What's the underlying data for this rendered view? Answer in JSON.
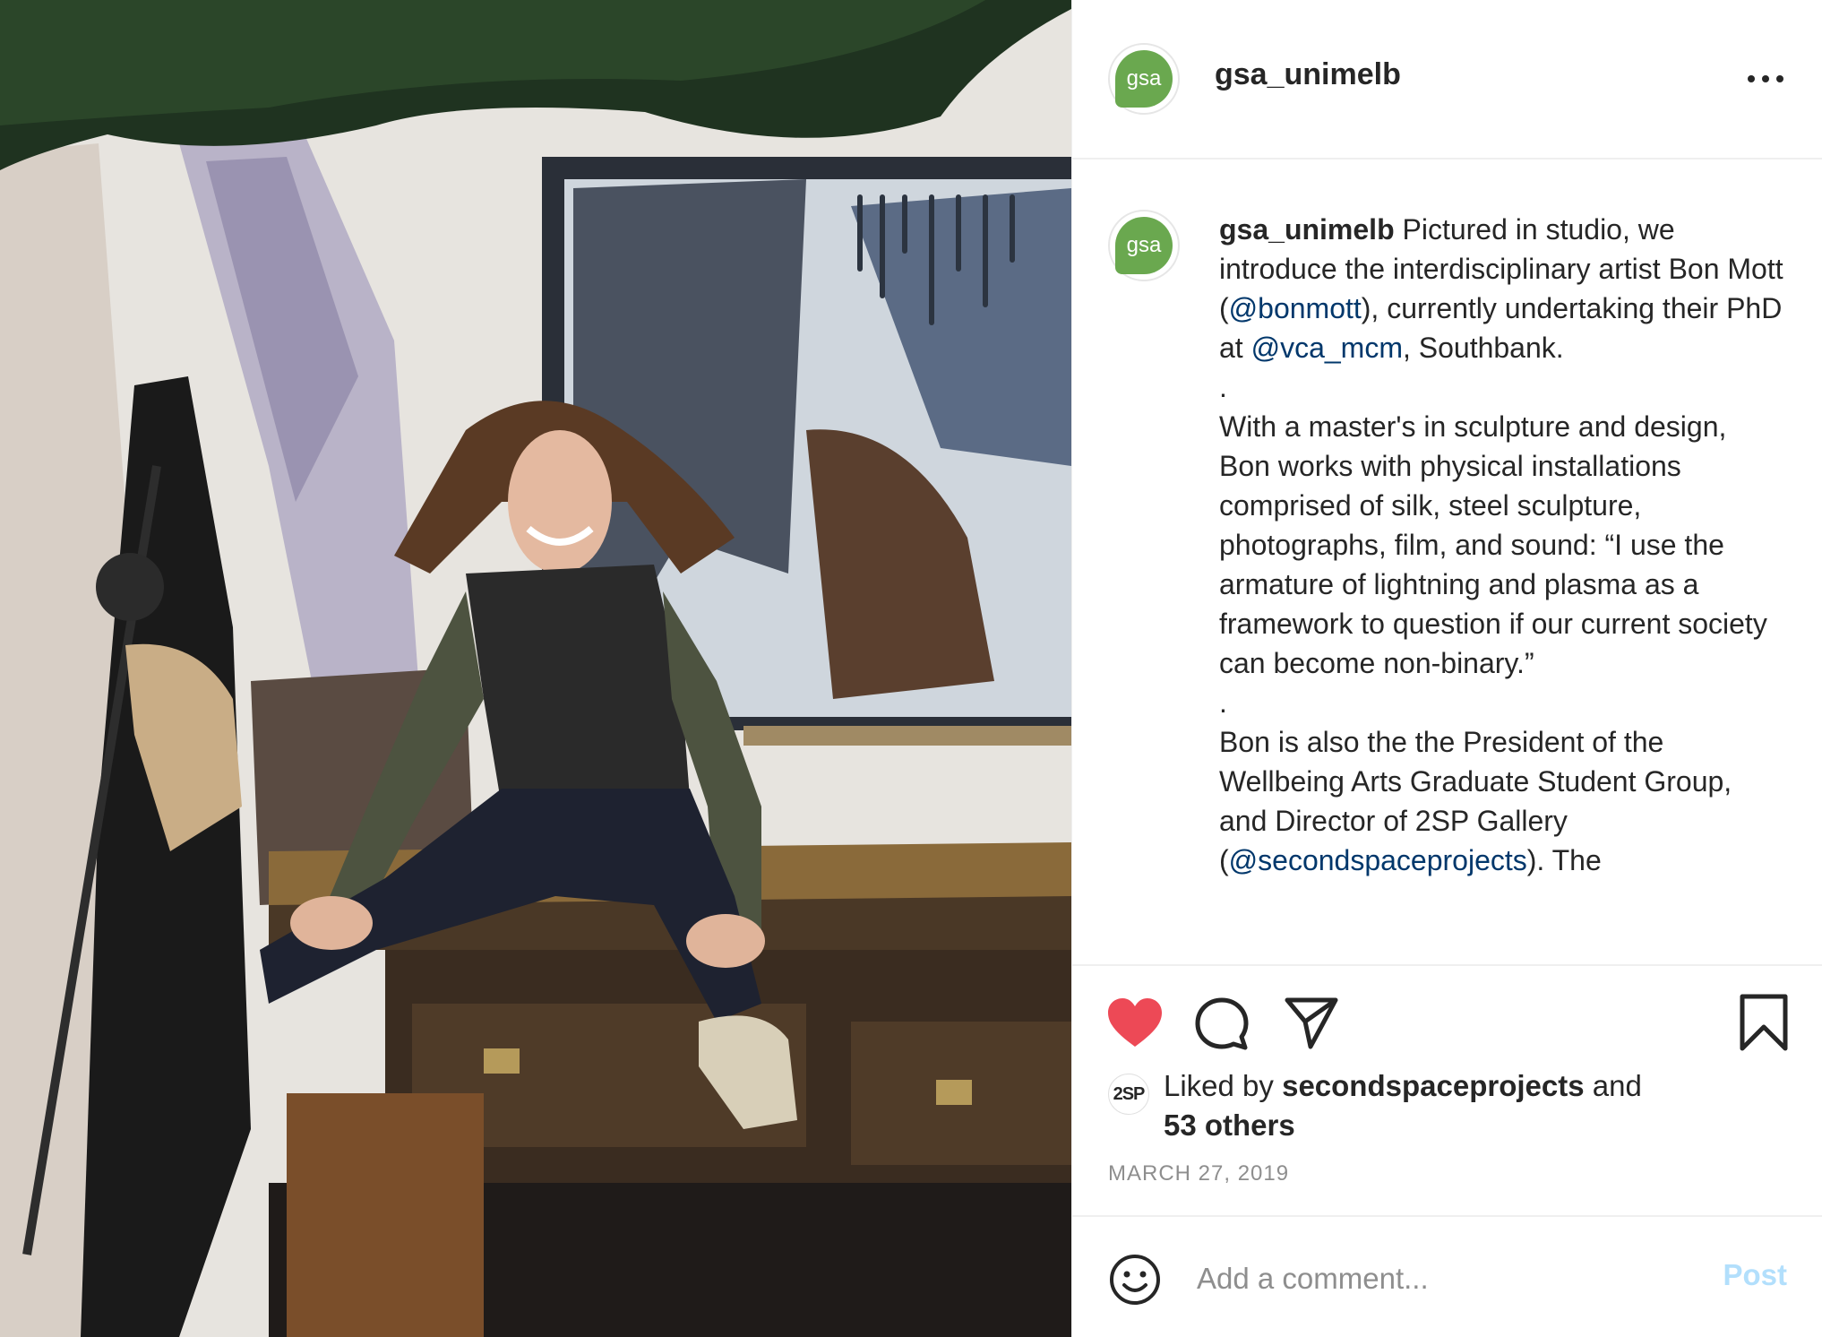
{
  "header": {
    "username": "gsa_unimelb",
    "avatar_text": "gsa",
    "more_icon": "more-dots-icon"
  },
  "caption": {
    "avatar_text": "gsa",
    "username": "gsa_unimelb",
    "p1_a": " Pictured in studio, we introduce the interdisciplinary artist Bon Mott (",
    "p1_mention1": "@bonmott",
    "p1_b": "), currently undertaking their PhD at ",
    "p1_mention2": "@vca_mcm",
    "p1_c": ", Southbank.",
    "dot1": ".",
    "p2": "With a master's in sculpture and design, Bon works with physical installations comprised of silk, steel sculpture, photographs, film, and sound: “I use the armature of lightning and plasma as a framework to question if our current society can become non-binary.”",
    "dot2": ".",
    "p3_a": "Bon is also the the President of the Wellbeing Arts Graduate Student Group, and Director of 2SP Gallery (",
    "p3_mention": "@secondspaceprojects",
    "p3_b": "). The"
  },
  "actions": {
    "like_icon": "heart-filled-icon",
    "comment_icon": "comment-icon",
    "share_icon": "paper-plane-icon",
    "save_icon": "bookmark-icon",
    "like_color": "#ed4956"
  },
  "likes": {
    "liker_avatar_text": "2SP",
    "prefix": "Liked by ",
    "liker": "secondspaceprojects",
    "middle": " and ",
    "others": "53 others"
  },
  "date": "MARCH 27, 2019",
  "comment": {
    "placeholder": "Add a comment...",
    "post_label": "Post",
    "emoji_icon": "smiley-icon"
  }
}
